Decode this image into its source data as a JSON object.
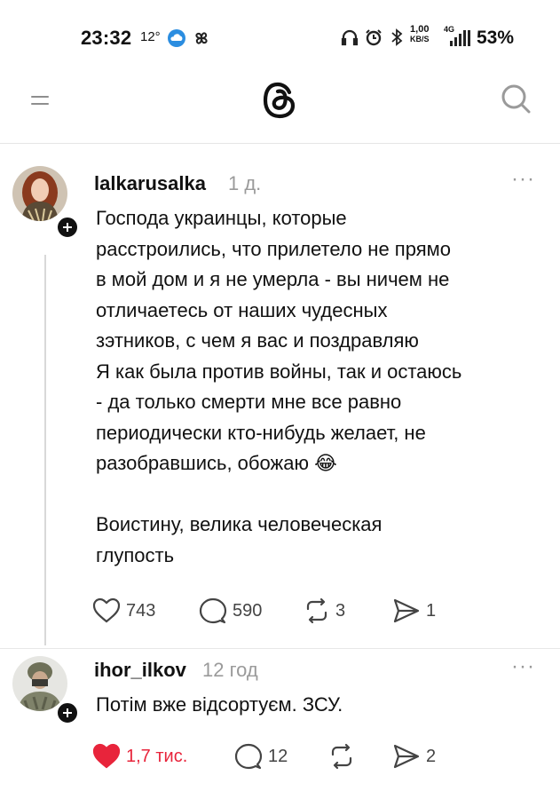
{
  "status_bar": {
    "time": "23:32",
    "temperature": "12°",
    "net_speed_value": "1,00",
    "net_speed_unit": "KB/S",
    "network_type": "4G",
    "battery": "53%",
    "icons": [
      "weather-cloud-icon",
      "pinwheel-icon",
      "headphones-icon",
      "alarm-icon",
      "bluetooth-icon",
      "signal-icon"
    ]
  },
  "header": {
    "menu_icon": "menu-icon",
    "logo_icon": "threads-logo-icon",
    "search_icon": "search-icon"
  },
  "posts": [
    {
      "username": "lalkarusalka",
      "timestamp": "1 д.",
      "text": "Господа украинцы, которые\nрасстроились, что прилетело не прямо\nв мой дом и я не умерла - вы ничем не\nотличаетесь от наших чудесных\nзэтников, с чем я вас и поздравляю\nЯ как была против войны, так и остаюсь\n- да только смерти мне все равно\nпериодически кто-нибудь желает, не\nразобравшись, обожаю 😂",
      "text2": "Воистину, велика человеческая\nглупость",
      "likes": "743",
      "replies": "590",
      "reposts": "3",
      "shares": "1",
      "liked": false
    },
    {
      "username": "ihor_ilkov",
      "timestamp": "12 год",
      "text": "Потім вже відсортуєм. ЗСУ.",
      "likes": "1,7 тис.",
      "replies": "12",
      "reposts": "",
      "shares": "2",
      "liked": true
    }
  ],
  "colors": {
    "like_active": "#e8243b",
    "muted_text": "#9a9a9a",
    "divider": "#e8e8e8"
  }
}
